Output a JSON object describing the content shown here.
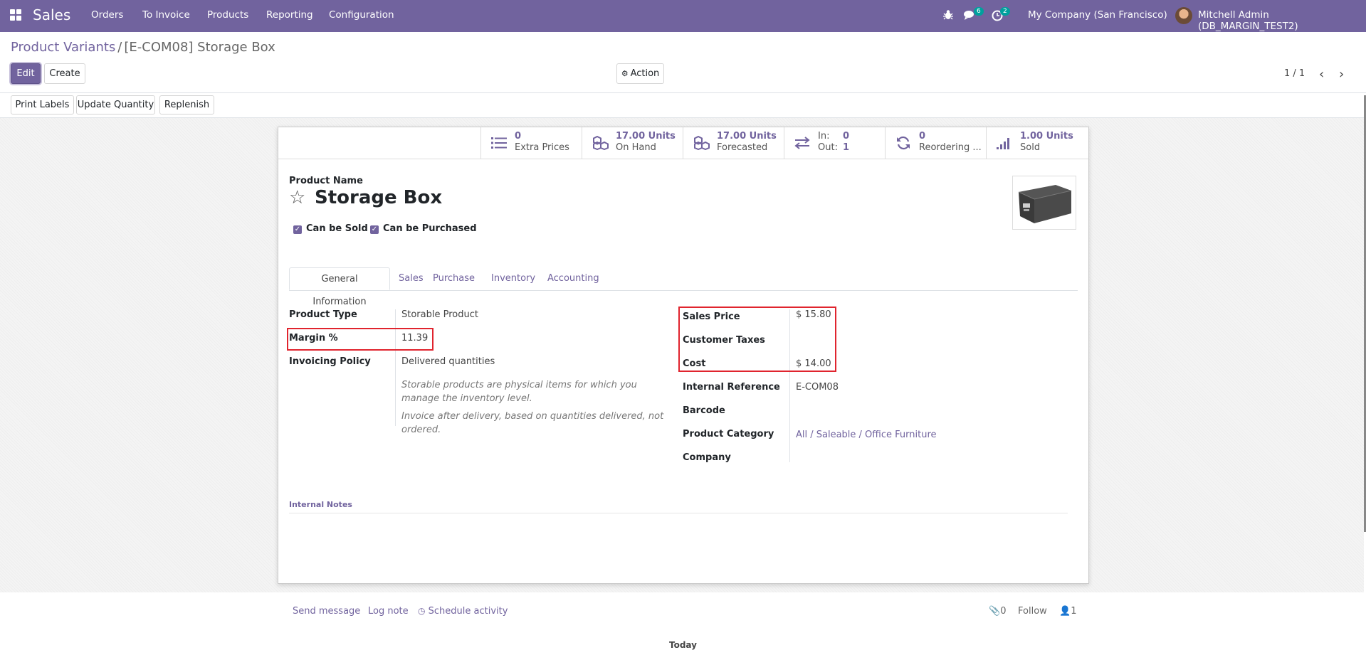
{
  "navbar": {
    "app_name": "Sales",
    "menu": [
      "Orders",
      "To Invoice",
      "Products",
      "Reporting",
      "Configuration"
    ],
    "messages_count": "6",
    "activities_count": "2",
    "company": "My Company (San Francisco)",
    "user": "Mitchell Admin (DB_MARGIN_TEST2)"
  },
  "breadcrumb": {
    "parent": "Product Variants",
    "separator": "/",
    "current": "[E-COM08] Storage Box"
  },
  "buttons": {
    "edit": "Edit",
    "create": "Create",
    "action": "Action",
    "print_labels": "Print Labels",
    "update_quantity": "Update Quantity",
    "replenish": "Replenish"
  },
  "pager": {
    "value": "1 / 1"
  },
  "stats": {
    "extra_prices": {
      "value": "0",
      "label": "Extra Prices"
    },
    "on_hand": {
      "value": "17.00 Units",
      "label": "On Hand"
    },
    "forecasted": {
      "value": "17.00 Units",
      "label": "Forecasted"
    },
    "in_out": {
      "in_label": "In:",
      "in_value": "0",
      "out_label": "Out:",
      "out_value": "1"
    },
    "reordering": {
      "value": "0",
      "label": "Reordering ..."
    },
    "sold": {
      "value": "1.00 Units",
      "label": "Sold"
    }
  },
  "product": {
    "name_label": "Product Name",
    "name": "Storage Box",
    "can_be_sold": "Can be Sold",
    "can_be_purchased": "Can be Purchased"
  },
  "tabs": [
    "General Information",
    "Sales",
    "Purchase",
    "Inventory",
    "Accounting"
  ],
  "left_fields": {
    "product_type_label": "Product Type",
    "product_type": "Storable Product",
    "margin_label": "Margin %",
    "margin": "11.39",
    "invoicing_policy_label": "Invoicing Policy",
    "invoicing_policy": "Delivered quantities",
    "help1": "Storable products are physical items for which you manage the inventory level.",
    "help2": "Invoice after delivery, based on quantities delivered, not ordered."
  },
  "right_fields": {
    "sales_price_label": "Sales Price",
    "sales_price": "$ 15.80",
    "customer_taxes_label": "Customer Taxes",
    "cost_label": "Cost",
    "cost": "$ 14.00",
    "internal_ref_label": "Internal Reference",
    "internal_ref": "E-COM08",
    "barcode_label": "Barcode",
    "category_label": "Product Category",
    "category": "All / Saleable / Office Furniture",
    "company_label": "Company"
  },
  "internal_notes_label": "Internal Notes",
  "chatter": {
    "send_message": "Send message",
    "log_note": "Log note",
    "schedule_activity": "Schedule activity",
    "attachments": "0",
    "follow": "Follow",
    "followers": "1",
    "today": "Today"
  },
  "colors": {
    "brand": "#71639e",
    "highlight": "#e0242e"
  }
}
